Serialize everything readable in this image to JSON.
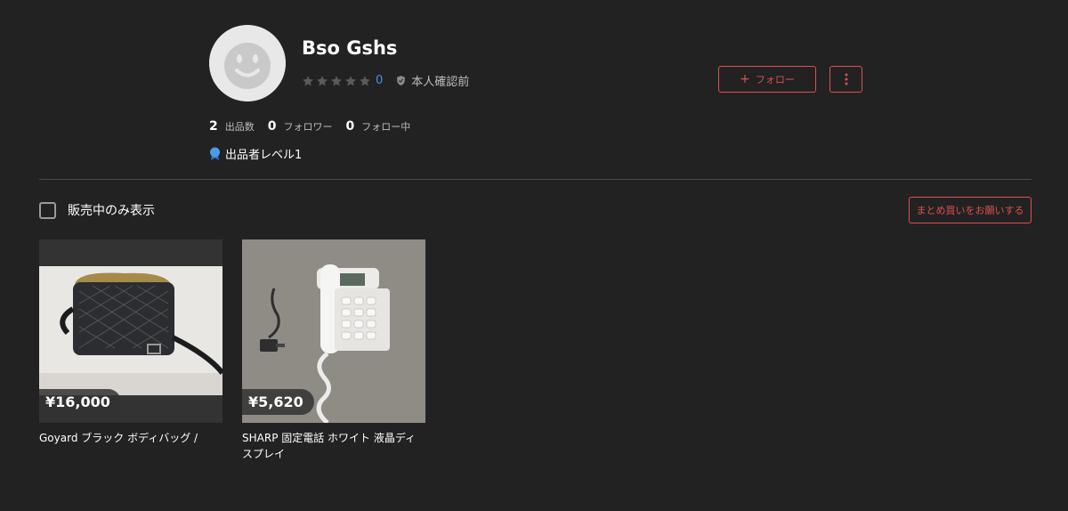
{
  "profile": {
    "name": "Bso Gshs",
    "rating_count": "0",
    "verify_label": "本人確認前",
    "follow_label": "フォロー",
    "stats": [
      {
        "num": "2",
        "label": "出品数"
      },
      {
        "num": "0",
        "label": "フォロワー"
      },
      {
        "num": "0",
        "label": "フォロー中"
      }
    ],
    "level_label": "出品者レベル1"
  },
  "filter": {
    "onsale_only_label": "販売中のみ表示",
    "bulk_request_label": "まとめ買いをお願いする"
  },
  "items": [
    {
      "price": "¥16,000",
      "title": "Goyard ブラック ボディバッグ /"
    },
    {
      "price": "¥5,620",
      "title": "SHARP 固定電話 ホワイト 液晶ディスプレイ"
    }
  ],
  "colors": {
    "background": "#222222",
    "accent": "#e0504f",
    "link_blue": "#4a90e2"
  }
}
